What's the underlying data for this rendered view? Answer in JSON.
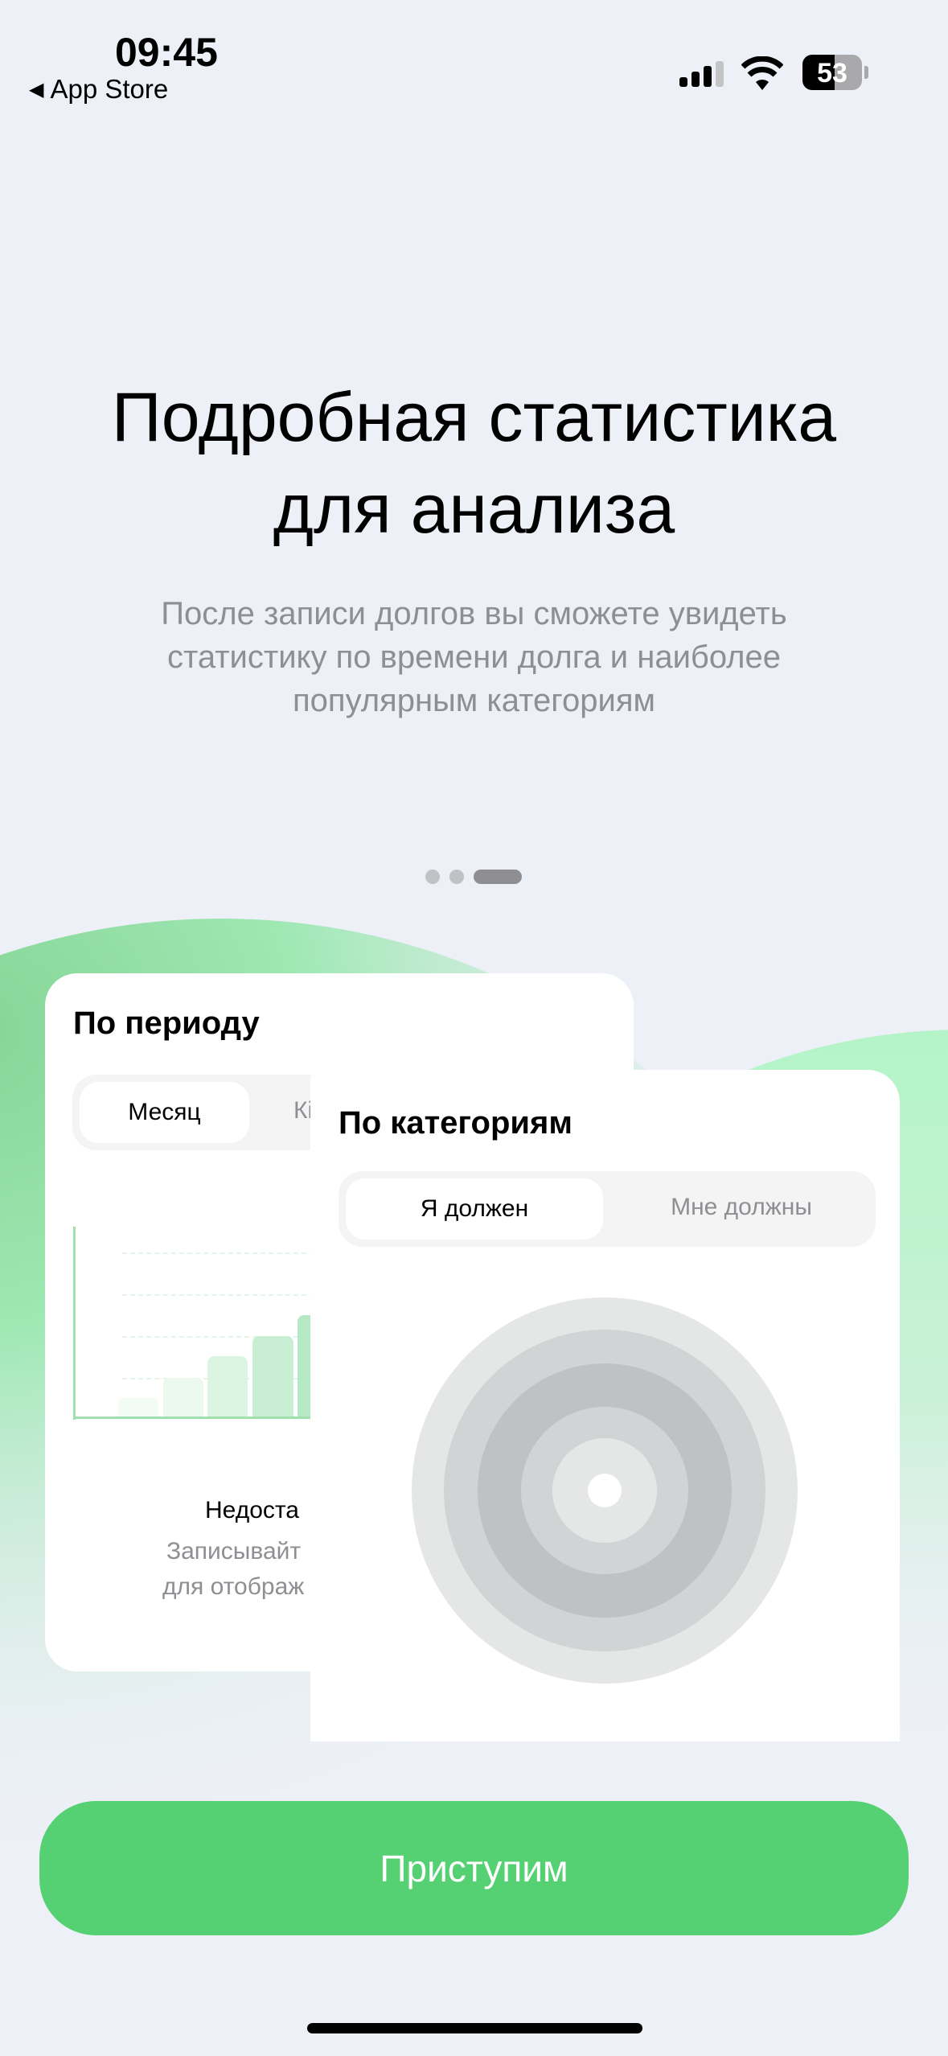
{
  "status_bar": {
    "time": "09:45",
    "back_label": "App Store",
    "battery": "53"
  },
  "onboarding": {
    "title_line1": "Подробная статистика",
    "title_line2": "для анализа",
    "subtitle_lines": [
      "После записи долгов вы сможете увидеть",
      "статистику по времени долга и наиболее",
      "популярным категориям"
    ],
    "page_indicator": {
      "pages": 3,
      "current": 3
    }
  },
  "period_card": {
    "title": "По периоду",
    "tabs": [
      "Месяц",
      "Кі"
    ],
    "empty_title": "Недоста",
    "empty_lines": [
      "Записывайт",
      "для отображ"
    ]
  },
  "category_card": {
    "title": "По категориям",
    "tabs": [
      "Я должен",
      "Мне должны"
    ],
    "ring_colors": [
      "#e5e6e6",
      "#d2d3d5",
      "#c0c1c3",
      "#d2d3d5",
      "#e5e6e6"
    ]
  },
  "cta": {
    "label": "Приступим",
    "color": "#55d072"
  }
}
